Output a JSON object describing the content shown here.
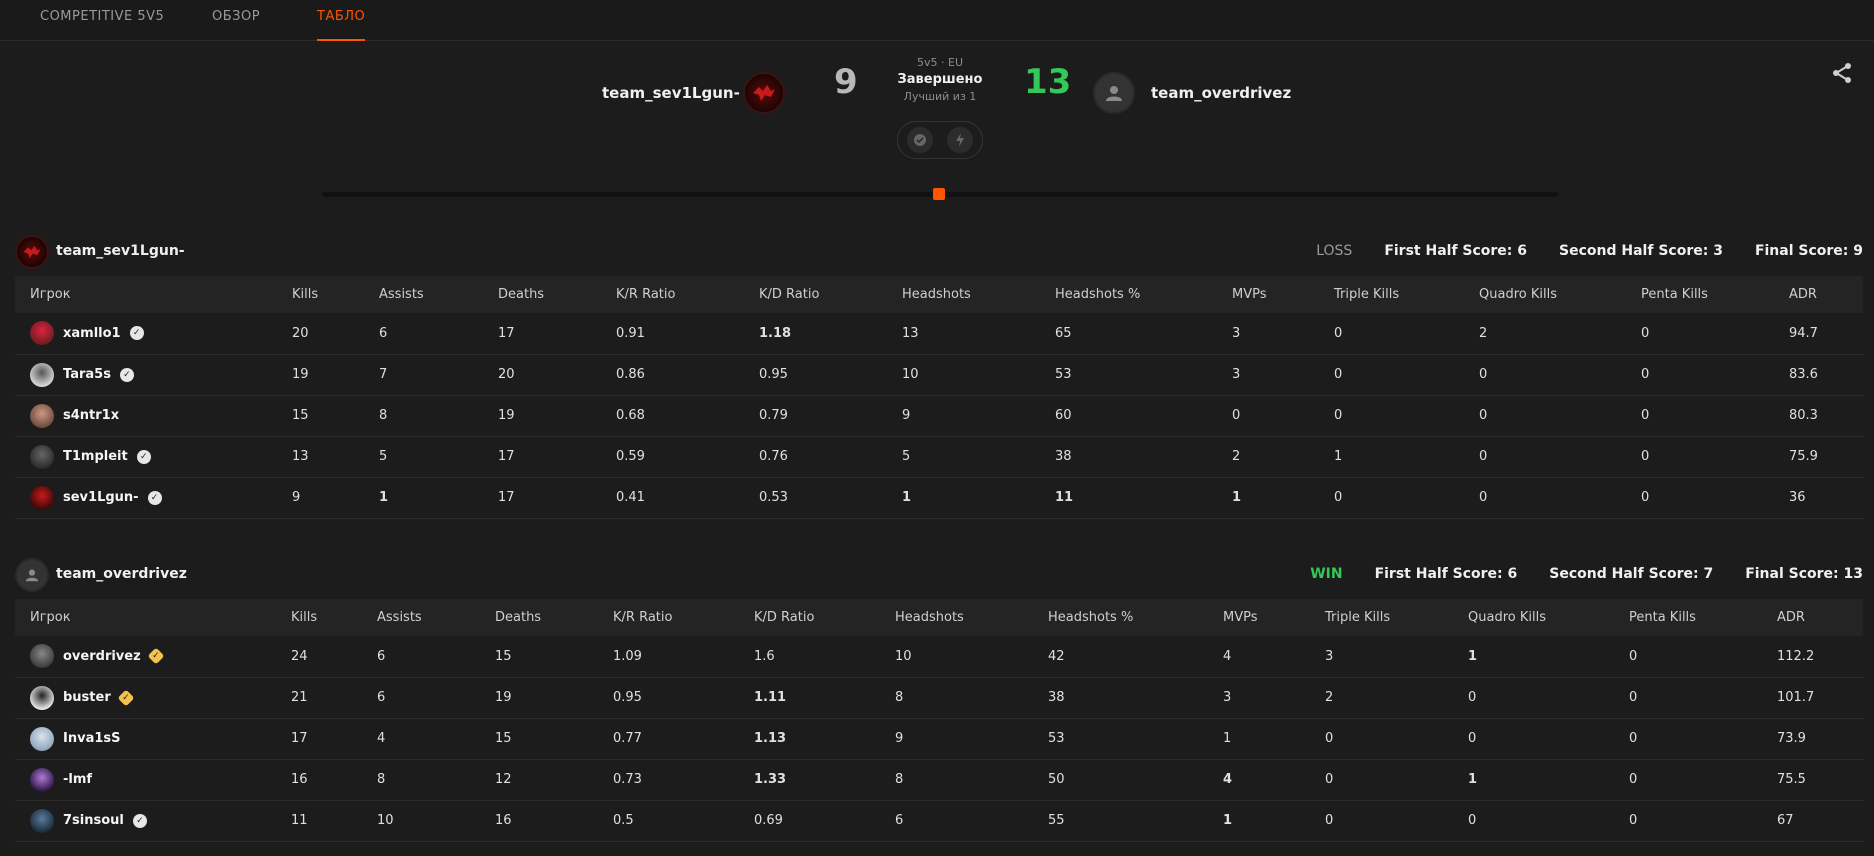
{
  "tabs": [
    {
      "label": "COMPETITIVE 5V5",
      "active": false
    },
    {
      "label": "ОБЗОР",
      "active": false
    },
    {
      "label": "ТАБЛО",
      "active": true
    }
  ],
  "match": {
    "mode": "5v5 · EU",
    "status": "Завершено",
    "format": "Лучший из 1",
    "team1": {
      "name": "team_sev1Lgun-",
      "score": "9"
    },
    "team2": {
      "name": "team_overdrivez",
      "score": "13"
    }
  },
  "columns": [
    "Игрок",
    "Kills",
    "Assists",
    "Deaths",
    "K/R Ratio",
    "K/D Ratio",
    "Headshots",
    "Headshots %",
    "MVPs",
    "Triple Kills",
    "Quadro Kills",
    "Penta Kills",
    "ADR"
  ],
  "teams": [
    {
      "name": "team_sev1Lgun-",
      "result": "LOSS",
      "first_half": "First Half Score: 6",
      "second_half": "Second Half Score: 3",
      "final": "Final Score: 9",
      "players": [
        {
          "name": "xamllo1",
          "badge": "verified",
          "stats": [
            "20",
            "6",
            "17",
            "0.91",
            "1.18",
            "13",
            "65",
            "3",
            "0",
            "2",
            "0",
            "94.7"
          ]
        },
        {
          "name": "Tara5s",
          "badge": "verified",
          "stats": [
            "19",
            "7",
            "20",
            "0.86",
            "0.95",
            "10",
            "53",
            "3",
            "0",
            "0",
            "0",
            "83.6"
          ]
        },
        {
          "name": "s4ntr1x",
          "badge": "",
          "stats": [
            "15",
            "8",
            "19",
            "0.68",
            "0.79",
            "9",
            "60",
            "0",
            "0",
            "0",
            "0",
            "80.3"
          ]
        },
        {
          "name": "T1mpleit",
          "badge": "verified",
          "stats": [
            "13",
            "5",
            "17",
            "0.59",
            "0.76",
            "5",
            "38",
            "2",
            "1",
            "0",
            "0",
            "75.9"
          ]
        },
        {
          "name": "sev1Lgun-",
          "badge": "verified",
          "stats": [
            "9",
            "1",
            "17",
            "0.41",
            "0.53",
            "1",
            "11",
            "1",
            "0",
            "0",
            "0",
            "36"
          ]
        }
      ]
    },
    {
      "name": "team_overdrivez",
      "result": "WIN",
      "first_half": "First Half Score: 6",
      "second_half": "Second Half Score: 7",
      "final": "Final Score: 13",
      "players": [
        {
          "name": "overdrivez",
          "badge": "gold",
          "stats": [
            "24",
            "6",
            "15",
            "1.09",
            "1.6",
            "10",
            "42",
            "4",
            "3",
            "1",
            "0",
            "112.2"
          ]
        },
        {
          "name": "buster",
          "badge": "gold",
          "stats": [
            "21",
            "6",
            "19",
            "0.95",
            "1.11",
            "8",
            "38",
            "3",
            "2",
            "0",
            "0",
            "101.7"
          ]
        },
        {
          "name": "Inva1sS",
          "badge": "",
          "stats": [
            "17",
            "4",
            "15",
            "0.77",
            "1.13",
            "9",
            "53",
            "1",
            "0",
            "0",
            "0",
            "73.9"
          ]
        },
        {
          "name": "-lmf",
          "badge": "",
          "stats": [
            "16",
            "8",
            "12",
            "0.73",
            "1.33",
            "8",
            "50",
            "4",
            "0",
            "1",
            "0",
            "75.5"
          ]
        },
        {
          "name": "7sinsoul",
          "badge": "verified",
          "stats": [
            "11",
            "10",
            "16",
            "0.5",
            "0.69",
            "6",
            "55",
            "1",
            "0",
            "0",
            "0",
            "67"
          ]
        }
      ]
    }
  ],
  "colors": {
    "accent": "#ff5500",
    "win": "#34c759",
    "loss": "#9a9a9a"
  }
}
